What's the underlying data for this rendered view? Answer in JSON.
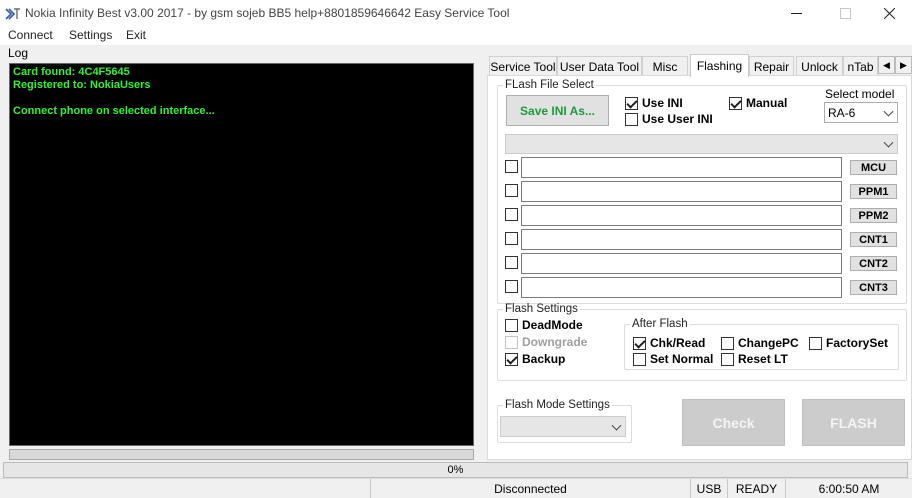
{
  "window": {
    "title": "Nokia Infinity Best v3.00 2017 - by gsm sojeb BB5 help+8801859646642 Easy Service Tool",
    "icon": "nokia-infinity-logo"
  },
  "menu": [
    "Connect",
    "Settings",
    "Exit"
  ],
  "log": {
    "label": "Log",
    "lines": [
      "Card found: 4C4F5645",
      "Registered to: NokiaUsers",
      "",
      "Connect phone on selected interface..."
    ]
  },
  "tabs": [
    "Service Tool",
    "User Data Tool",
    "Misc",
    "Flashing",
    "Repair",
    "Unlock",
    "nTab"
  ],
  "active_tab": "Flashing",
  "flash_file_select": {
    "legend": "FLash File Select",
    "save_ini_label": "Save INI As...",
    "use_ini": {
      "label": "Use INI",
      "checked": true
    },
    "use_user_ini": {
      "label": "Use User INI",
      "checked": false
    },
    "manual": {
      "label": "Manual",
      "checked": true
    },
    "select_model_label": "Select model",
    "model_value": "RA-6",
    "product_value": "",
    "files": [
      {
        "button": "MCU",
        "path": "",
        "checked": false
      },
      {
        "button": "PPM1",
        "path": "",
        "checked": false
      },
      {
        "button": "PPM2",
        "path": "",
        "checked": false
      },
      {
        "button": "CNT1",
        "path": "",
        "checked": false
      },
      {
        "button": "CNT2",
        "path": "",
        "checked": false
      },
      {
        "button": "CNT3",
        "path": "",
        "checked": false
      }
    ]
  },
  "flash_settings": {
    "legend": "Flash Settings",
    "deadmode": {
      "label": "DeadMode",
      "checked": false
    },
    "downgrade": {
      "label": "Downgrade",
      "checked": false,
      "disabled": true
    },
    "backup": {
      "label": "Backup",
      "checked": true
    },
    "after_flash": {
      "legend": "After Flash",
      "chk_read": {
        "label": "Chk/Read",
        "checked": true
      },
      "change_pc": {
        "label": "ChangePC",
        "checked": false
      },
      "factory_set": {
        "label": "FactorySet",
        "checked": false
      },
      "set_normal": {
        "label": "Set Normal",
        "checked": false
      },
      "reset_lt": {
        "label": "Reset LT",
        "checked": false
      }
    }
  },
  "flash_mode_settings": {
    "legend": "Flash Mode Settings",
    "value": ""
  },
  "actions": {
    "check_label": "Check",
    "flash_label": "FLASH"
  },
  "progress": {
    "text": "0%",
    "value": 0
  },
  "status": {
    "connection": "Disconnected",
    "interface": "USB",
    "state": "READY",
    "time": "6:00:50 AM"
  },
  "colors": {
    "log_bg": "#000000",
    "log_text": "#2ef32e",
    "save_ini_text": "#1e9a3c",
    "progress_fill": "#06b025"
  }
}
